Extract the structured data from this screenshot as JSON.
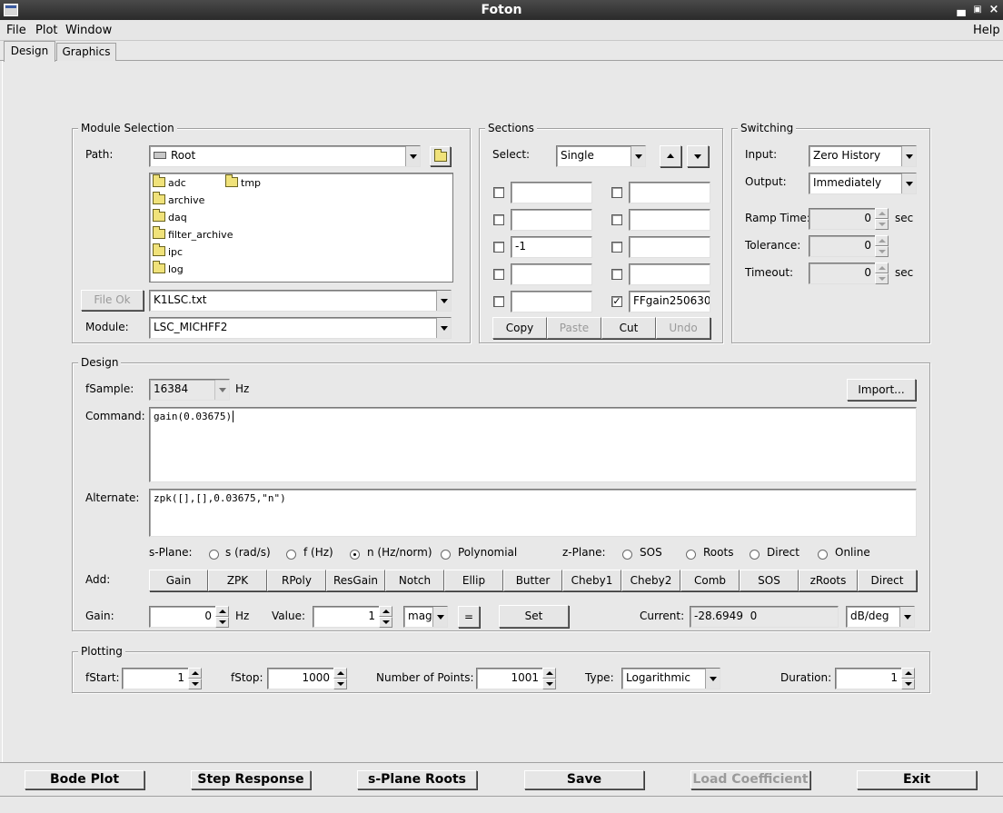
{
  "window": {
    "title": "Foton"
  },
  "menubar": {
    "file": "File",
    "plot": "Plot",
    "window": "Window",
    "help": "Help"
  },
  "tabs": {
    "design": "Design",
    "graphics": "Graphics"
  },
  "module_selection": {
    "title": "Module Selection",
    "path_label": "Path:",
    "path_value": "Root",
    "folders": [
      "adc",
      "tmp",
      "archive",
      "daq",
      "filter_archive",
      "ipc",
      "log"
    ],
    "file_ok_label": "File Ok",
    "file_value": "K1LSC.txt",
    "module_label": "Module:",
    "module_value": "LSC_MICHFF2"
  },
  "sections": {
    "title": "Sections",
    "select_label": "Select:",
    "select_value": "Single",
    "left": [
      {
        "checked": false,
        "name": ""
      },
      {
        "checked": false,
        "name": ""
      },
      {
        "checked": false,
        "name": "-1"
      },
      {
        "checked": false,
        "name": ""
      },
      {
        "checked": false,
        "name": ""
      }
    ],
    "right": [
      {
        "checked": false,
        "name": ""
      },
      {
        "checked": false,
        "name": ""
      },
      {
        "checked": false,
        "name": ""
      },
      {
        "checked": false,
        "name": ""
      },
      {
        "checked": true,
        "name": "FFgain250630"
      }
    ],
    "copy": "Copy",
    "paste": "Paste",
    "cut": "Cut",
    "undo": "Undo"
  },
  "switching": {
    "title": "Switching",
    "input_label": "Input:",
    "input_value": "Zero History",
    "output_label": "Output:",
    "output_value": "Immediately",
    "ramp_label": "Ramp Time:",
    "ramp_value": "0",
    "ramp_unit": "sec",
    "tolerance_label": "Tolerance:",
    "tolerance_value": "0",
    "timeout_label": "Timeout:",
    "timeout_value": "0",
    "timeout_unit": "sec"
  },
  "design": {
    "title": "Design",
    "fsample_label": "fSample:",
    "fsample_value": "16384",
    "fsample_unit": "Hz",
    "import_label": "Import...",
    "command_label": "Command:",
    "command_value": "gain(0.03675)",
    "alternate_label": "Alternate:",
    "alternate_value": "zpk([],[],0.03675,\"n\")",
    "splane_label": "s-Plane:",
    "splane_options": [
      "s (rad/s)",
      "f (Hz)",
      "n (Hz/norm)",
      "Polynomial"
    ],
    "splane_selected": 2,
    "zplane_label": "z-Plane:",
    "zplane_options": [
      "SOS",
      "Roots",
      "Direct",
      "Online"
    ],
    "add_label": "Add:",
    "add_buttons": [
      "Gain",
      "ZPK",
      "RPoly",
      "ResGain",
      "Notch",
      "Ellip",
      "Butter",
      "Cheby1",
      "Cheby2",
      "Comb",
      "SOS",
      "zRoots",
      "Direct"
    ],
    "gain_label": "Gain:",
    "gain_value": "0",
    "gain_unit": "Hz",
    "value_label": "Value:",
    "value_value": "1",
    "value_mode": "mag",
    "equals_label": "=",
    "set_label": "Set",
    "current_label": "Current:",
    "current_value": "-28.6949  0",
    "current_unit": "dB/deg"
  },
  "plotting": {
    "title": "Plotting",
    "fstart_label": "fStart:",
    "fstart_value": "1",
    "fstop_label": "fStop:",
    "fstop_value": "1000",
    "npoints_label": "Number of Points:",
    "npoints_value": "1001",
    "type_label": "Type:",
    "type_value": "Logarithmic",
    "duration_label": "Duration:",
    "duration_value": "1"
  },
  "bottom": {
    "bode": "Bode Plot",
    "step": "Step Response",
    "roots": "s-Plane Roots",
    "save": "Save",
    "load": "Load Coefficient",
    "exit": "Exit"
  }
}
